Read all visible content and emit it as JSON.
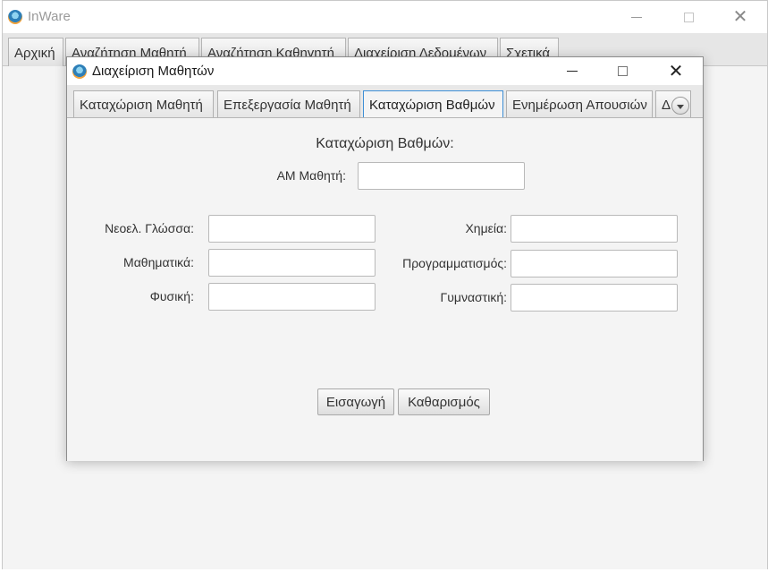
{
  "main_window": {
    "title": "InWare",
    "tabs": [
      {
        "label": "Αρχική"
      },
      {
        "label": "Αναζήτηση Μαθητή"
      },
      {
        "label": "Αναζήτηση Καθηγητή"
      },
      {
        "label": "Διαχείριση Δεδομένων"
      },
      {
        "label": "Σχετικά"
      }
    ]
  },
  "dialog": {
    "title": "Διαχείριση Μαθητών",
    "tabs": [
      {
        "label": "Καταχώριση Μαθητή"
      },
      {
        "label": "Επεξεργασία Μαθητή"
      },
      {
        "label": "Καταχώριση Βαθμών",
        "active": true
      },
      {
        "label": "Ενημέρωση Απουσιών"
      },
      {
        "label": "Δ"
      }
    ],
    "form": {
      "heading": "Καταχώριση Βαθμών:",
      "student_id_label": "ΑΜ Μαθητή:",
      "student_id_value": "",
      "left_subjects": [
        {
          "label": "Νεοελ. Γλώσσα:",
          "value": ""
        },
        {
          "label": "Μαθηματικά:",
          "value": ""
        },
        {
          "label": "Φυσική:",
          "value": ""
        }
      ],
      "right_subjects": [
        {
          "label": "Χημεία:",
          "value": ""
        },
        {
          "label": "Προγραμματισμός:",
          "value": ""
        },
        {
          "label": "Γυμναστική:",
          "value": ""
        }
      ],
      "submit_label": "Εισαγωγή",
      "clear_label": "Καθαρισμός"
    }
  },
  "icons": {
    "app": "app-logo-icon",
    "minimize": "minimize-icon",
    "maximize": "maximize-icon",
    "close": "close-icon",
    "tab_overflow": "chevron-down-icon"
  },
  "colors": {
    "active_tab_border": "#3d8fd6",
    "window_bg": "#f4f4f4"
  }
}
